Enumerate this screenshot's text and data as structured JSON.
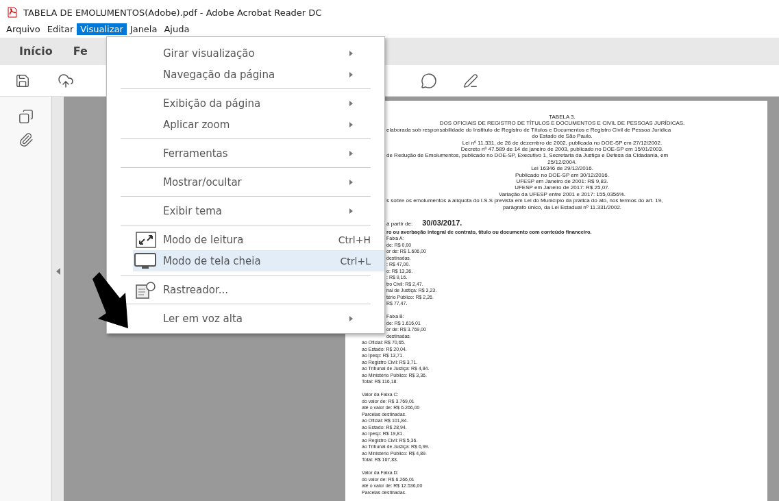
{
  "window": {
    "title": "TABELA DE EMOLUMENTOS(Adobe).pdf - Adobe Acrobat Reader DC"
  },
  "menubar": [
    {
      "label": "Arquivo",
      "selected": false
    },
    {
      "label": "Editar",
      "selected": false
    },
    {
      "label": "Visualizar",
      "selected": true
    },
    {
      "label": "Janela",
      "selected": false
    },
    {
      "label": "Ajuda",
      "selected": false
    }
  ],
  "tabs": [
    {
      "label": "Início",
      "selected": false
    },
    {
      "label": "Fe",
      "selected": false
    }
  ],
  "menu": [
    {
      "kind": "item",
      "label": "Girar visualização",
      "submenu": true,
      "selected": false
    },
    {
      "kind": "item",
      "label": "Navegação da página",
      "submenu": true,
      "selected": false
    },
    {
      "kind": "separator"
    },
    {
      "kind": "item",
      "label": "Exibição da página",
      "submenu": true,
      "selected": false
    },
    {
      "kind": "item",
      "label": "Aplicar zoom",
      "submenu": true,
      "selected": false
    },
    {
      "kind": "separator"
    },
    {
      "kind": "item",
      "label": "Ferramentas",
      "submenu": true,
      "selected": false
    },
    {
      "kind": "separator"
    },
    {
      "kind": "item",
      "label": "Mostrar/ocultar",
      "submenu": true,
      "selected": false
    },
    {
      "kind": "separator"
    },
    {
      "kind": "item",
      "label": "Exibir tema",
      "submenu": true,
      "selected": false
    },
    {
      "kind": "separator"
    },
    {
      "kind": "item",
      "label": "Modo de leitura",
      "shortcut": "Ctrl+H",
      "submenu": false,
      "selected": false
    },
    {
      "kind": "item",
      "label": "Modo de tela cheia",
      "shortcut": "Ctrl+L",
      "submenu": false,
      "selected": true
    },
    {
      "kind": "separator"
    },
    {
      "kind": "item",
      "label": "Rastreador...",
      "submenu": false,
      "selected": false
    },
    {
      "kind": "separator"
    },
    {
      "kind": "item",
      "label": "Ler em voz alta",
      "submenu": true,
      "selected": false
    }
  ],
  "document": {
    "header": [
      {
        "kind": "full",
        "text": "TABELA 3."
      },
      {
        "kind": "full",
        "text": "DOS OFICIAIS DE REGISTRO DE TÍTULOS E DOCUMENTOS E CIVIL DE PESSOAS JURÍDICAS."
      },
      {
        "kind": "cut",
        "text": "elaborada sob responsabilidade do Instituto de Registro de Títulos e Documentos e Registro Civil de Pessoa Jurídica"
      },
      {
        "kind": "full",
        "text": "do Estado de São Paulo."
      },
      {
        "kind": "full",
        "text": "Lei nº 11.331, de 26 de dezembro de 2002, publicada no DOE-SP em 27/12/2002."
      },
      {
        "kind": "full",
        "text": "Decreto nº 47.589 de 14 de janeiro de 2003, publicado no DOE-SP em 15/01/2003."
      },
      {
        "kind": "cut",
        "text": "de Redução de Emolumentos, publicado no DOE-SP, Executivo 1, Secretaria da Justiça e Defesa da Cidadania, em"
      },
      {
        "kind": "full",
        "text": "25/12/2004."
      },
      {
        "kind": "full",
        "text": "Lei 16346 de 29/12/2016."
      },
      {
        "kind": "full",
        "text": "Publicado no DOE-SP em 30/12/2016."
      },
      {
        "kind": "full",
        "text": "UFESP em Janeiro de 2001: R$ 9,83."
      },
      {
        "kind": "full",
        "text": "UFESP em Janeiro de 2017: R$ 25,07."
      },
      {
        "kind": "full",
        "text": "Variação da UFESP entre 2001 e 2017: 155,0356%."
      },
      {
        "kind": "cut",
        "text": "s sobre os emolumentos a alíquota do I.S.S prevista em Lei do Município da prática do ato, nos termos do art. 19,"
      },
      {
        "kind": "full",
        "text": "parágrafo único, da Lei Estadual nº 11.331/2002."
      }
    ],
    "date_label": "à partir de:",
    "date": "30/03/2017.",
    "heading": "ro ou averbação integral de contrato, título ou documento com conteúdo financeiro.",
    "lines": [
      {
        "kind": "cut",
        "text": "Faixa A:"
      },
      {
        "kind": "cut",
        "text": "de: R$ 0,00"
      },
      {
        "kind": "cut",
        "text": "or de: R$ 1.606,00"
      },
      {
        "kind": "cut",
        "text": "destinadas."
      },
      {
        "kind": "cut",
        "text": ": R$ 47,00."
      },
      {
        "kind": "cut",
        "text": "o: R$ 13,36."
      },
      {
        "kind": "cut",
        "text": ": R$ 9,16."
      },
      {
        "kind": "cut",
        "text": "tro Civil: R$ 2,47."
      },
      {
        "kind": "cut",
        "text": "nal de Justiça: R$ 3,23."
      },
      {
        "kind": "cut",
        "text": "tério Público: R$ 2,26."
      },
      {
        "kind": "cut",
        "text": "R$ 77,47."
      },
      {
        "kind": "blank"
      },
      {
        "kind": "cut",
        "text": "Faixa B:"
      },
      {
        "kind": "cut",
        "text": "de: R$ 1.616,01"
      },
      {
        "kind": "cut",
        "text": "or de: R$ 3.769,00"
      },
      {
        "kind": "cut",
        "text": "destinadas."
      },
      {
        "kind": "full",
        "text": "ao Oficial: R$ 70,65."
      },
      {
        "kind": "full",
        "text": "ao Estado: R$ 20,04."
      },
      {
        "kind": "full",
        "text": "ao Ipesp: R$ 13,71."
      },
      {
        "kind": "full",
        "text": "ao Registro Civil: R$ 3,71."
      },
      {
        "kind": "full",
        "text": "ao Tribunal de Justiça: R$ 4,84."
      },
      {
        "kind": "full",
        "text": "ao Ministério Público: R$ 3,36."
      },
      {
        "kind": "full",
        "text": "Total: R$ 116,18."
      },
      {
        "kind": "blank"
      },
      {
        "kind": "full",
        "text": "Valor da Faixa C:"
      },
      {
        "kind": "full",
        "text": "do valor de: R$ 3.769,01"
      },
      {
        "kind": "full",
        "text": "até o valor de: R$ 6.266,00"
      },
      {
        "kind": "full",
        "text": "Parcelas destinadas."
      },
      {
        "kind": "full",
        "text": "ao Oficial: R$ 101,84."
      },
      {
        "kind": "full",
        "text": "ao Estado: R$ 28,94."
      },
      {
        "kind": "full",
        "text": "ao Ipesp: R$ 19,81."
      },
      {
        "kind": "full",
        "text": "ao Registro Civil: R$ 5,36."
      },
      {
        "kind": "full",
        "text": "ao Tribunal de Justiça: R$ 6,99."
      },
      {
        "kind": "full",
        "text": "ao Ministério Público: R$ 4,89."
      },
      {
        "kind": "full",
        "text": "Total: R$ 167,83."
      },
      {
        "kind": "blank"
      },
      {
        "kind": "full",
        "text": "Valor da Faixa D:"
      },
      {
        "kind": "full",
        "text": "do valor de: R$ 6.266,01"
      },
      {
        "kind": "full",
        "text": "até o valor de: R$ 12.536,00"
      },
      {
        "kind": "full",
        "text": "Parcelas destinadas."
      }
    ]
  }
}
